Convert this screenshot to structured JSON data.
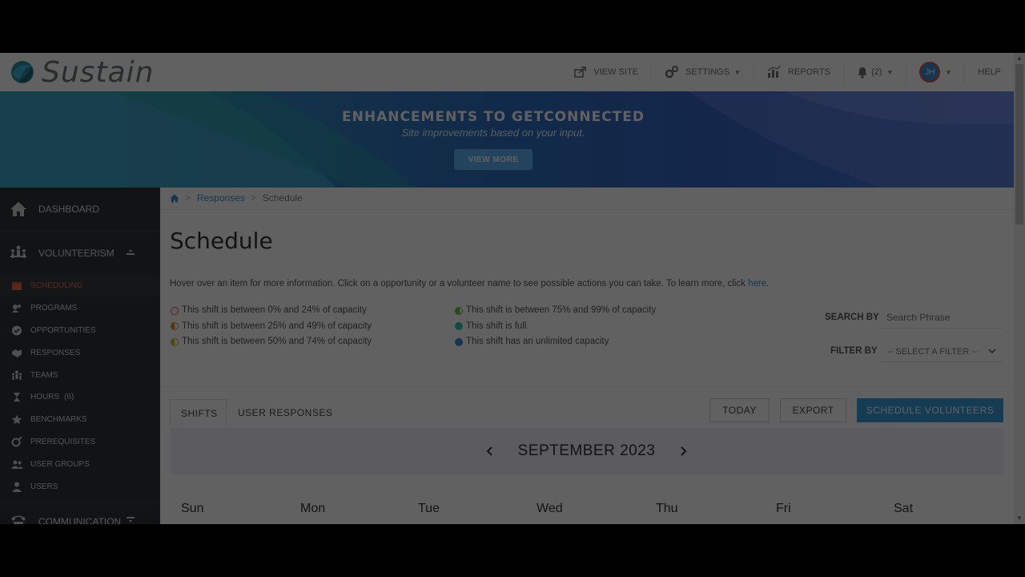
{
  "brand": {
    "name": "Sustain"
  },
  "nav": {
    "view_site": "VIEW SITE",
    "settings": "SETTINGS",
    "reports": "REPORTS",
    "notifications": "(2)",
    "user_initials": "JH",
    "help": "HELP"
  },
  "banner": {
    "title": "ENHANCEMENTS TO GETCONNECTED",
    "subtitle": "Site improvements based on your input.",
    "button": "VIEW MORE"
  },
  "sidebar": {
    "dashboard": "DASHBOARD",
    "volunteerism": "VOLUNTEERISM",
    "items": [
      {
        "label": "SCHEDULING",
        "icon": "calendar-icon"
      },
      {
        "label": "PROGRAMS",
        "icon": "programs-icon"
      },
      {
        "label": "OPPORTUNITIES",
        "icon": "check-circle-icon"
      },
      {
        "label": "RESPONSES",
        "icon": "handshake-icon"
      },
      {
        "label": "TEAMS",
        "icon": "team-icon"
      },
      {
        "label": "HOURS",
        "icon": "hourglass-icon",
        "badge": "(6)"
      },
      {
        "label": "BENCHMARKS",
        "icon": "star-icon"
      },
      {
        "label": "PREREQUISITES",
        "icon": "prerequisite-icon"
      },
      {
        "label": "USER GROUPS",
        "icon": "user-group-icon"
      },
      {
        "label": "USERS",
        "icon": "user-icon"
      }
    ],
    "communication": "COMMUNICATION"
  },
  "breadcrumb": {
    "parent": "Responses",
    "current": "Schedule"
  },
  "page": {
    "title": "Schedule",
    "hint_text": "Hover over an item for more information. Click on a opportunity or a volunteer name to see possible actions you can take. To learn more, click ",
    "hint_link": "here",
    "hint_end": "."
  },
  "legend": [
    {
      "text": "This shift is between 0% and 24% of capacity",
      "color": "#e5533d"
    },
    {
      "text": "This shift is between 25% and 49% of capacity",
      "color": "#f08a24"
    },
    {
      "text": "This shift is between 50% and 74% of capacity",
      "color": "#c4c21d"
    },
    {
      "text": "This shift is between 75% and 99% of capacity",
      "color": "#6cc24a"
    },
    {
      "text": "This shift is full",
      "color": "#2ec4b6"
    },
    {
      "text": "This shift has an unlimited capacity",
      "color": "#3a8fd1"
    }
  ],
  "search": {
    "label": "SEARCH BY",
    "placeholder": "Search Phrase"
  },
  "filter": {
    "label": "FILTER BY",
    "selected": "-- SELECT A FILTER --"
  },
  "tabs": {
    "shifts": "SHIFTS",
    "user_responses": "USER RESPONSES"
  },
  "buttons": {
    "today": "TODAY",
    "export": "EXPORT",
    "schedule": "SCHEDULE VOLUNTEERS"
  },
  "calendar": {
    "month": "SEPTEMBER 2023",
    "days": [
      "Sun",
      "Mon",
      "Tue",
      "Wed",
      "Thu",
      "Fri",
      "Sat"
    ]
  }
}
